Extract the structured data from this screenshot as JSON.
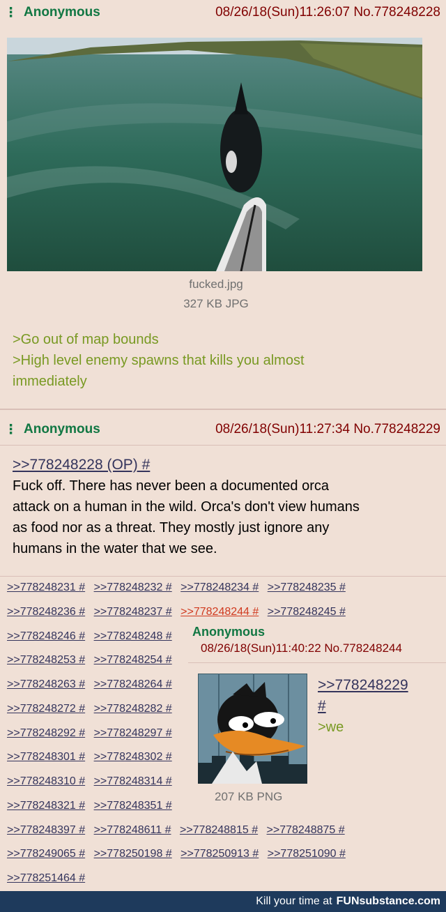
{
  "post1": {
    "name": "Anonymous",
    "datetime": "08/26/18(Sun)11:26:07",
    "number": "No.778248228",
    "file_name": "fucked.jpg",
    "file_meta": "327 KB JPG",
    "lines": [
      ">Go out of map bounds",
      ">High level enemy spawns that kills you almost",
      "immediately"
    ]
  },
  "post2": {
    "name": "Anonymous",
    "datetime": "08/26/18(Sun)11:27:34",
    "number": "No.778248229",
    "quote": ">>778248228 (OP) #",
    "body": [
      "Fuck off. There has never been a documented orca",
      "attack on a human in the wild. Orca's don't view humans",
      "as food nor as a threat. They mostly just ignore any",
      "humans in the water that we see."
    ]
  },
  "refs": {
    "row1": [
      ">>778248231 #",
      ">>778248232 #",
      ">>778248234 #",
      ">>778248235 #"
    ],
    "row2": [
      ">>778248236 #",
      ">>778248237 #",
      ">>778248244 #",
      ">>778248245 #"
    ],
    "row3": [
      ">>778248246 #",
      ">>778248248 #"
    ],
    "row4": [
      ">>778248253 #",
      ">>778248254 #"
    ],
    "row5": [
      ">>778248263 #",
      ">>778248264 #"
    ],
    "row6": [
      ">>778248272 #",
      ">>778248282 #"
    ],
    "row7": [
      ">>778248292 #",
      ">>778248297 #"
    ],
    "row8": [
      ">>778248301 #",
      ">>778248302 #"
    ],
    "row9": [
      ">>778248310 #",
      ">>778248314 #"
    ],
    "row10": [
      ">>778248321 #",
      ">>778248351 #"
    ],
    "row11": [
      ">>778248397 #",
      ">>778248611 #",
      ">>778248815 #",
      ">>778248875 #"
    ],
    "row12": [
      ">>778249065 #",
      ">>778250198 #",
      ">>778250913 #",
      ">>778251090 #"
    ],
    "row13": [
      ">>778251464 #"
    ]
  },
  "reply": {
    "name": "Anonymous",
    "datetime": "08/26/18(Sun)11:40:22",
    "number": "No.778248244",
    "quote": ">>778248229",
    "hash": "#",
    "text": ">we",
    "file_meta": "207 KB PNG"
  },
  "footer": {
    "text": "Kill your time at",
    "brand": "FUNsubstance.com"
  },
  "colors": {
    "post_bg": "#f0e0d6",
    "name": "#117743",
    "greentext": "#789922",
    "quotelink": "#34345c",
    "highlight": "#d03a1f"
  }
}
